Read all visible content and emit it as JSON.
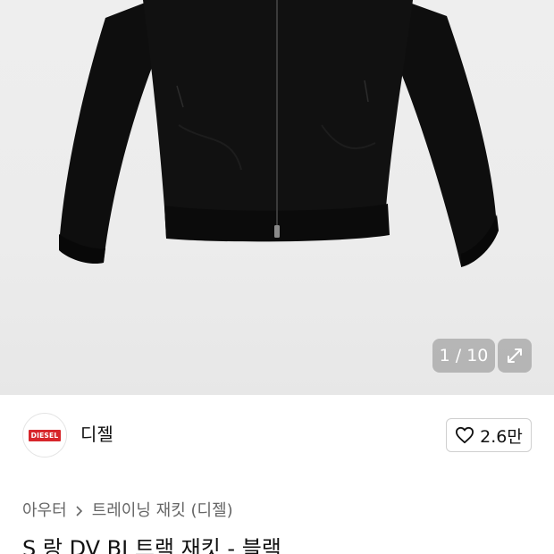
{
  "gallery": {
    "counter": "1 / 10",
    "image_alt": "black zip-up track jacket"
  },
  "brand": {
    "logo_text": "DIESEL",
    "name": "디젤",
    "likes": "2.6만"
  },
  "breadcrumb": {
    "items": [
      "아우터",
      "트레이닝 재킷 (디젤)"
    ]
  },
  "product": {
    "title": "S 랑 DV BJ 트랙 재킷 - 블랙"
  },
  "icons": {
    "expand": "expand-icon",
    "heart": "heart-icon",
    "chevron": "chevron-right-icon"
  },
  "colors": {
    "accent_logo": "#d7262b",
    "overlay": "#969696"
  }
}
